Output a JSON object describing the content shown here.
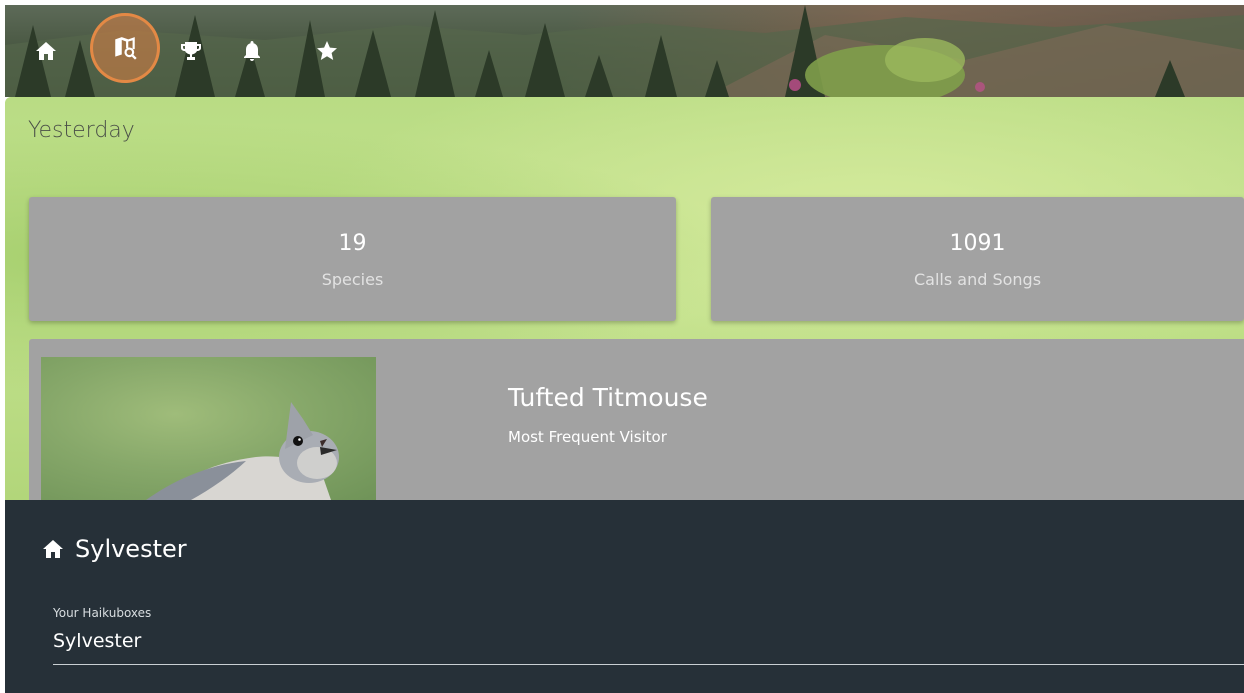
{
  "nav": {
    "items": [
      {
        "name": "home",
        "icon": "home-icon",
        "active": false
      },
      {
        "name": "map-search",
        "icon": "map-search-icon",
        "active": true
      },
      {
        "name": "trophy",
        "icon": "trophy-icon",
        "active": false
      },
      {
        "name": "notifications",
        "icon": "bell-icon",
        "active": false
      },
      {
        "name": "favorites",
        "icon": "star-icon",
        "active": false
      }
    ],
    "active_color": "#dc8246"
  },
  "summary": {
    "title": "Yesterday",
    "species": {
      "value": "19",
      "label": "Species"
    },
    "calls": {
      "value": "1091",
      "label": "Calls and Songs"
    },
    "top_visitor": {
      "name": "Tufted Titmouse",
      "subtitle": "Most Frequent Visitor",
      "image": "tufted-titmouse-photo"
    }
  },
  "haikubox": {
    "name": "Sylvester",
    "select_label": "Your Haikuboxes",
    "selected": "Sylvester"
  },
  "colors": {
    "panel_green": "#bddd87",
    "card_gray": "#a2a2a2",
    "bottom_dark": "#263038"
  }
}
